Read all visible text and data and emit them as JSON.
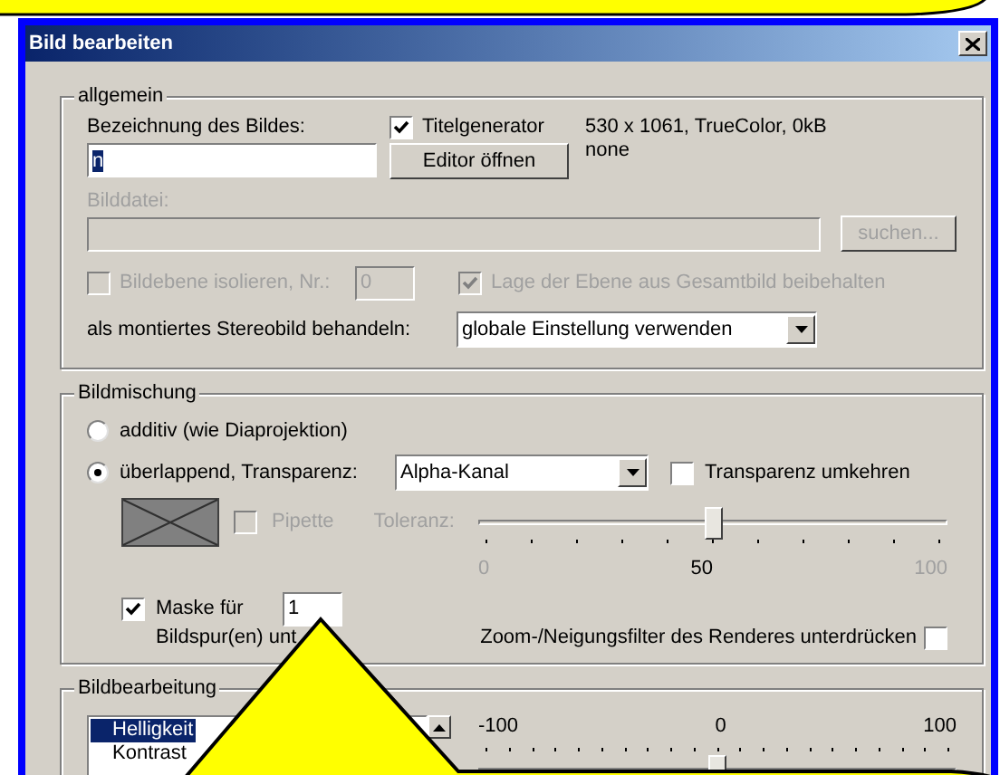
{
  "window": {
    "title": "Bild bearbeiten"
  },
  "allgemein": {
    "legend": "allgemein",
    "name_label": "Bezeichnung des Bildes:",
    "name_value": "n",
    "title_generator": {
      "label": "Titelgenerator",
      "checked": true
    },
    "editor_button": "Editor öffnen",
    "info": [
      "530 x 1061, TrueColor, 0kB",
      "none"
    ],
    "file_label": "Bilddatei:",
    "file_disabled": true,
    "browse_button": "suchen...",
    "isolate": {
      "label": "Bildebene isolieren, Nr.:",
      "checked": false,
      "disabled": true,
      "number": "0"
    },
    "keep_position": {
      "label": "Lage der Ebene aus Gesamtbild beibehalten",
      "checked": true,
      "disabled": true
    },
    "stereo_label": "als montiertes Stereobild behandeln:",
    "stereo_value": "globale Einstellung verwenden"
  },
  "bildmischung": {
    "legend": "Bildmischung",
    "modes": [
      {
        "label": "additiv (wie Diaprojektion)",
        "selected": false
      },
      {
        "label": "überlappend, Transparenz:",
        "selected": true
      }
    ],
    "transparency_value": "Alpha-Kanal",
    "invert": {
      "label": "Transparenz umkehren",
      "checked": false
    },
    "pipette": {
      "label": "Pipette",
      "checked": false,
      "disabled": true
    },
    "tolerance": {
      "label": "Toleranz:",
      "level": 0.5,
      "disabled": true,
      "ticks": [
        {
          "label": "0",
          "selected": false
        },
        {
          "label": "50",
          "selected": true
        },
        {
          "label": "100",
          "selected": false
        }
      ]
    },
    "mask": {
      "label": "Maske für",
      "checked": true,
      "value": "1",
      "suffix": "Bildspur(en) unt"
    },
    "suppress": {
      "label": "Zoom-/Neigungsfilter des Renderes unterdrücken",
      "checked": false
    }
  },
  "bildbearbeitung": {
    "legend": "Bildbearbeitung",
    "items": [
      {
        "label": "Helligkeit",
        "selected": true
      },
      {
        "label": "Kontrast",
        "selected": false
      }
    ],
    "scale": [
      "-100",
      "0",
      "100"
    ],
    "level": 0.5
  }
}
